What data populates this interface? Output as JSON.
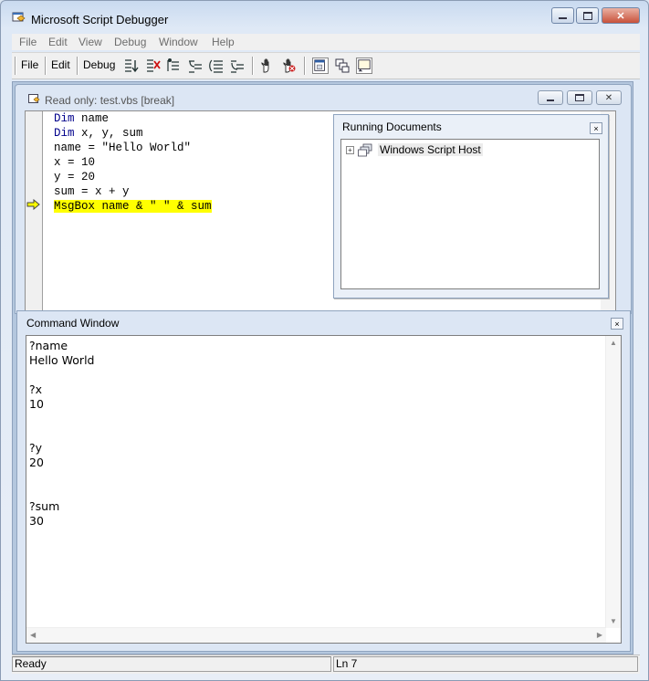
{
  "window": {
    "title": "Microsoft Script Debugger"
  },
  "menubar": {
    "items": [
      "File",
      "Edit",
      "View",
      "Debug",
      "Window",
      "Help"
    ]
  },
  "toolbar": {
    "file_label": "File",
    "edit_label": "Edit",
    "debug_label": "Debug"
  },
  "document": {
    "title": "Read only: test.vbs [break]",
    "lines": [
      {
        "kw": "Dim",
        "rest": " name"
      },
      {
        "kw": "Dim",
        "rest": " x, y, sum"
      },
      {
        "kw": "",
        "rest": "name = \"Hello World\""
      },
      {
        "kw": "",
        "rest": "x = 10"
      },
      {
        "kw": "",
        "rest": "y = 20"
      },
      {
        "kw": "",
        "rest": "sum = x + y"
      },
      {
        "kw": "",
        "rest": "MsgBox name & \" \" & sum"
      }
    ],
    "current_line_index": 6
  },
  "running_documents": {
    "title": "Running Documents",
    "close_glyph": "×",
    "items": [
      {
        "label": "Windows Script Host",
        "expand_glyph": "+"
      }
    ]
  },
  "command_window": {
    "title": "Command Window",
    "close_glyph": "×",
    "content": "?name\nHello World\n\n?x\n10\n\n\n?y\n20\n\n\n?sum\n30"
  },
  "statusbar": {
    "status": "Ready",
    "line": "Ln 7"
  }
}
